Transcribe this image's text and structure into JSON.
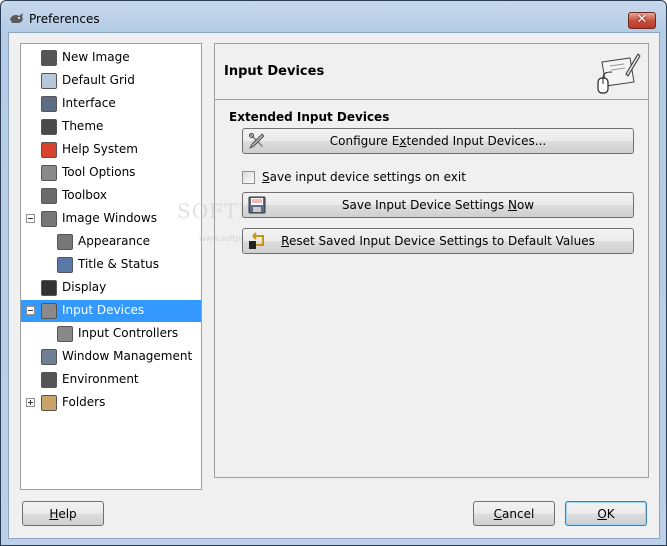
{
  "window": {
    "title": "Preferences",
    "close_label": "✕"
  },
  "sidebar": {
    "items": [
      {
        "label": "New Image",
        "icon": "new-image-icon",
        "level": 0
      },
      {
        "label": "Default Grid",
        "icon": "grid-icon",
        "level": 0
      },
      {
        "label": "Interface",
        "icon": "interface-icon",
        "level": 0
      },
      {
        "label": "Theme",
        "icon": "theme-icon",
        "level": 0
      },
      {
        "label": "Help System",
        "icon": "lifebuoy-icon",
        "level": 0
      },
      {
        "label": "Tool Options",
        "icon": "tool-options-icon",
        "level": 0
      },
      {
        "label": "Toolbox",
        "icon": "tools-icon",
        "level": 0
      },
      {
        "label": "Image Windows",
        "icon": "image-window-icon",
        "level": 0,
        "expander": "expanded"
      },
      {
        "label": "Appearance",
        "icon": "image-window-icon",
        "level": 1
      },
      {
        "label": "Title & Status",
        "icon": "title-status-icon",
        "level": 1
      },
      {
        "label": "Display",
        "icon": "display-icon",
        "level": 0
      },
      {
        "label": "Input Devices",
        "icon": "input-devices-icon",
        "level": 0,
        "expander": "expanded",
        "selected": true
      },
      {
        "label": "Input Controllers",
        "icon": "input-controllers-icon",
        "level": 1
      },
      {
        "label": "Window Management",
        "icon": "window-management-icon",
        "level": 0
      },
      {
        "label": "Environment",
        "icon": "environment-icon",
        "level": 0
      },
      {
        "label": "Folders",
        "icon": "folder-icon",
        "level": 0,
        "expander": "collapsed"
      }
    ]
  },
  "panel": {
    "title": "Input Devices",
    "section_title": "Extended Input Devices",
    "configure_button": {
      "pre": "Configure E",
      "mnemonic": "x",
      "post": "tended Input Devices..."
    },
    "save_on_exit": {
      "mnemonic": "S",
      "post": "ave input device settings on exit",
      "checked": false
    },
    "save_now_button": {
      "pre": "Save Input Device Settings ",
      "mnemonic": "N",
      "post": "ow"
    },
    "reset_button": {
      "pre": "",
      "mnemonic": "R",
      "post": "eset Saved Input Device Settings to Default Values"
    }
  },
  "footer": {
    "help": {
      "mnemonic": "H",
      "post": "elp"
    },
    "cancel": {
      "mnemonic": "C",
      "post": "ancel"
    },
    "ok": {
      "mnemonic": "O",
      "post": "K"
    }
  },
  "watermark": {
    "text": "SOFTPEDIA",
    "sub": "www.softpedia.com"
  },
  "colors": {
    "selection": "#3399ff",
    "dialog_bg": "#f0f0f0",
    "title_bar": "#bcd1e8"
  }
}
